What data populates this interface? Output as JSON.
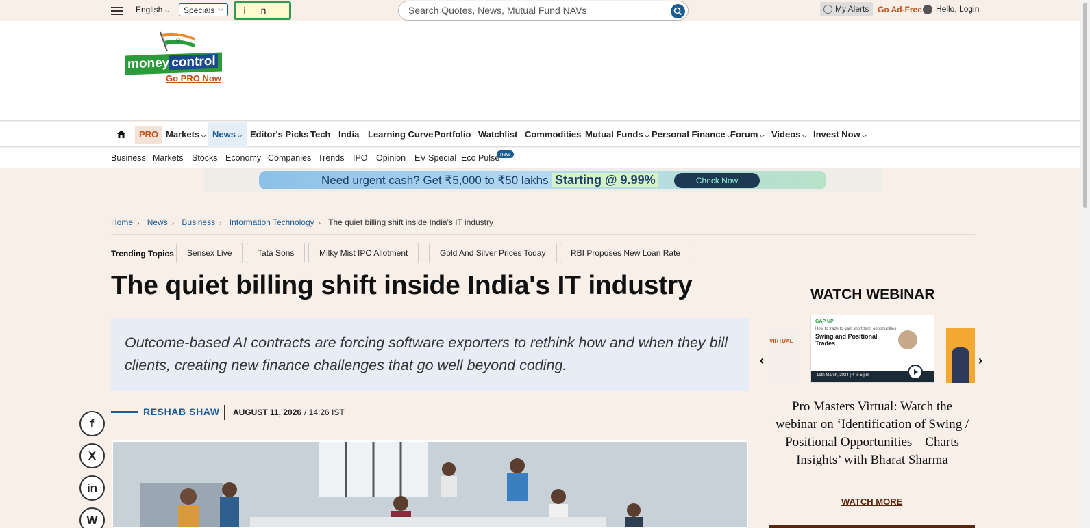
{
  "topbar": {
    "language": "English",
    "specials": "Specials",
    "promo_text": "in",
    "search_placeholder": "Search Quotes, News, Mutual Fund NAVs",
    "alerts": "My Alerts",
    "ad_free": "Go Ad-Free",
    "login": "Hello, Login"
  },
  "logo": {
    "brand_left": "money",
    "brand_right": "control",
    "go_pro": "Go PRO Now"
  },
  "nav": {
    "items": [
      "PRO",
      "Markets",
      "News",
      "Editor's Picks",
      "Tech",
      "India",
      "Learning Curve",
      "Portfolio",
      "Watchlist",
      "Commodities",
      "Mutual Funds",
      "Personal Finance",
      "Forum",
      "Videos",
      "Invest Now"
    ],
    "sub": [
      "Business",
      "Markets",
      "Stocks",
      "Economy",
      "Companies",
      "Trends",
      "IPO",
      "Opinion",
      "EV Special",
      "Eco Pulse"
    ],
    "new_badge": "new"
  },
  "banner": {
    "text1": "Need urgent cash? Get ₹5,000 to ₹50 lakhs",
    "text2": "Starting @ 9.99%",
    "cta": "Check Now"
  },
  "breadcrumb": [
    "Home",
    "News",
    "Business",
    "Information Technology",
    "The quiet billing shift inside India's IT industry"
  ],
  "trending": {
    "label": "Trending Topics",
    "topics": [
      "Sensex Live",
      "Tata Sons",
      "Milky Mist IPO Allotment",
      "Gold And Silver Prices Today",
      "RBI Proposes New Loan Rate"
    ]
  },
  "article": {
    "title": "The quiet billing shift inside India's IT industry",
    "summary": "Outcome-based AI contracts are forcing software exporters to rethink how and when they bill clients, creating new finance challenges that go well beyond coding.",
    "author": "RESHAB SHAW",
    "date": "AUGUST 11, 2026",
    "time": "/ 14:26 IST"
  },
  "social": [
    "f",
    "X",
    "in",
    "W"
  ],
  "webinar": {
    "heading": "WATCH WEBINAR",
    "card_brand": "GAP UP",
    "card_small": "How to trade to gain short term opportunities",
    "card_title": "Swing and Positional Trades",
    "card_date": "19th March, 2024  |  4 to 5 pm",
    "side_left": "VIRTUAL",
    "description": "Pro Masters Virtual: Watch the webinar on ‘Identification of Swing / Positional Opportunities – Charts Insights’ with Bharat Sharma",
    "more": "WATCH MORE",
    "prev": "‹",
    "next": "›"
  }
}
